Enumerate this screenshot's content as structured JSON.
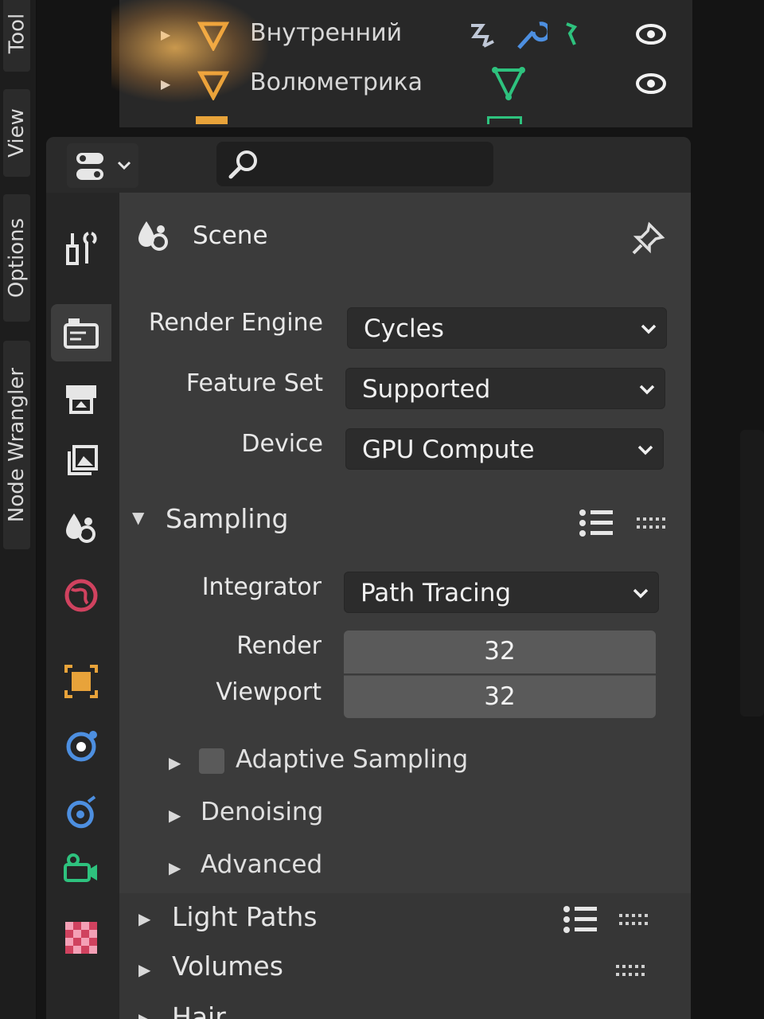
{
  "side_tabs": [
    {
      "label": "Tool"
    },
    {
      "label": "View"
    },
    {
      "label": "Options"
    },
    {
      "label": "Node Wrangler"
    }
  ],
  "outliner": {
    "rows": [
      {
        "name": "Внутренний"
      },
      {
        "name": "Волюметрика"
      }
    ]
  },
  "properties": {
    "context_title": "Scene",
    "render_engine": {
      "label": "Render Engine",
      "value": "Cycles"
    },
    "feature_set": {
      "label": "Feature Set",
      "value": "Supported"
    },
    "device": {
      "label": "Device",
      "value": "GPU Compute"
    },
    "sampling": {
      "title": "Sampling",
      "integrator": {
        "label": "Integrator",
        "value": "Path Tracing"
      },
      "render": {
        "label": "Render",
        "value": "32"
      },
      "viewport": {
        "label": "Viewport",
        "value": "32"
      },
      "subpanels": [
        "Adaptive Sampling",
        "Denoising",
        "Advanced"
      ]
    },
    "panels": [
      "Light Paths",
      "Volumes",
      "Hair"
    ]
  },
  "colors": {
    "accent_orange": "#e8a33a",
    "accent_blue": "#4d8fe0",
    "accent_green": "#2ec27e",
    "accent_red": "#d0425f"
  }
}
